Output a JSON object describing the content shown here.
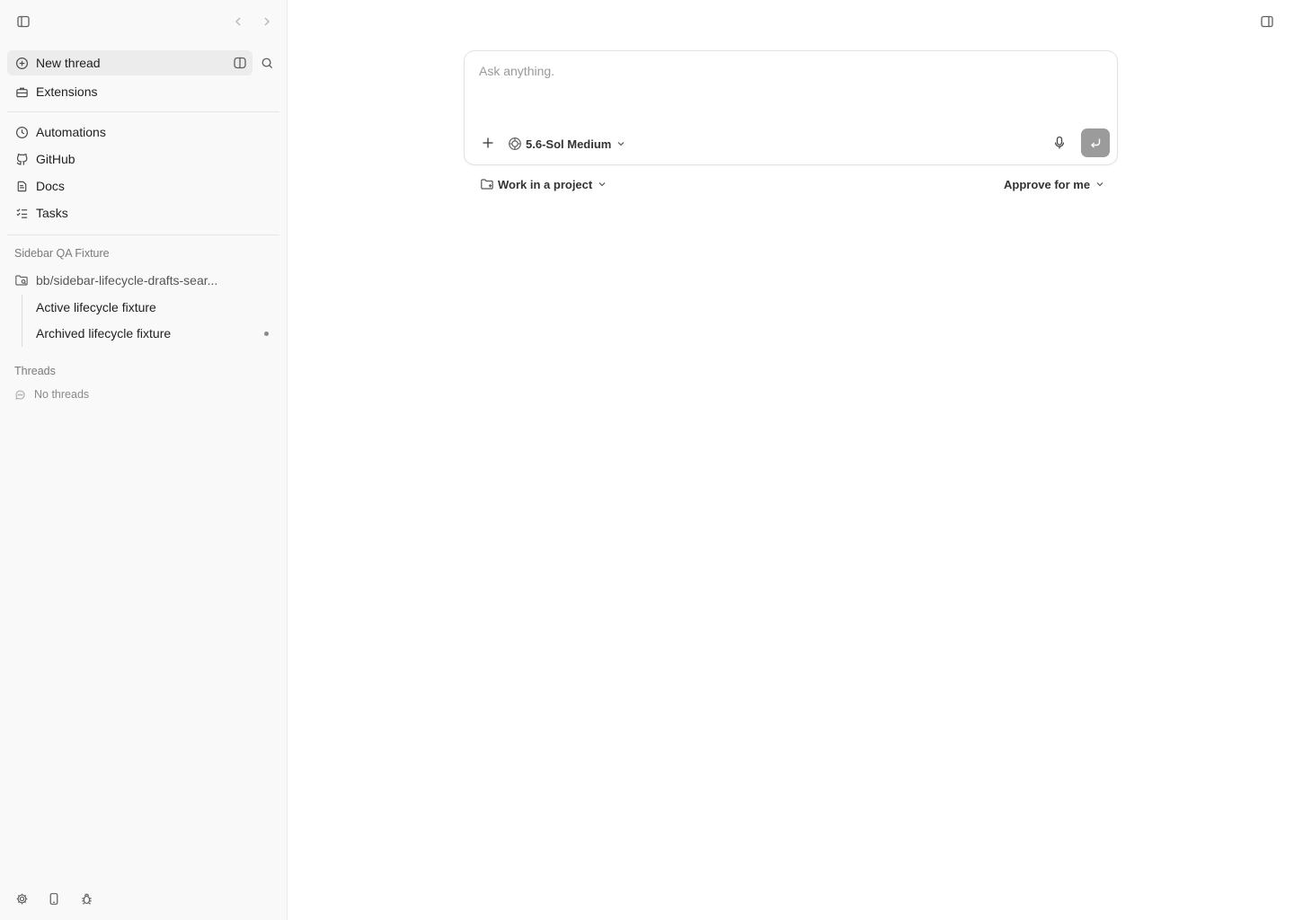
{
  "sidebar": {
    "nav": {
      "new_thread": "New thread",
      "extensions": "Extensions",
      "automations": "Automations",
      "github": "GitHub",
      "docs": "Docs",
      "tasks": "Tasks"
    },
    "project_section": {
      "label": "Sidebar QA Fixture",
      "project_name": "bb/sidebar-lifecycle-drafts-sear...",
      "threads": [
        "Active lifecycle fixture",
        "Archived lifecycle fixture"
      ]
    },
    "threads_section": {
      "label": "Threads",
      "empty": "No threads"
    }
  },
  "composer": {
    "placeholder": "Ask anything.",
    "model": "5.6-Sol Medium"
  },
  "below_composer": {
    "project": "Work in a project",
    "approval": "Approve for me"
  },
  "icons": {
    "sidebar_toggle": "sidebar-toggle-icon",
    "back": "chevron-left-icon",
    "forward": "chevron-right-icon",
    "panel": "panel-right-icon",
    "settings": "gear-icon",
    "phone": "phone-icon",
    "bug": "bug-icon"
  }
}
